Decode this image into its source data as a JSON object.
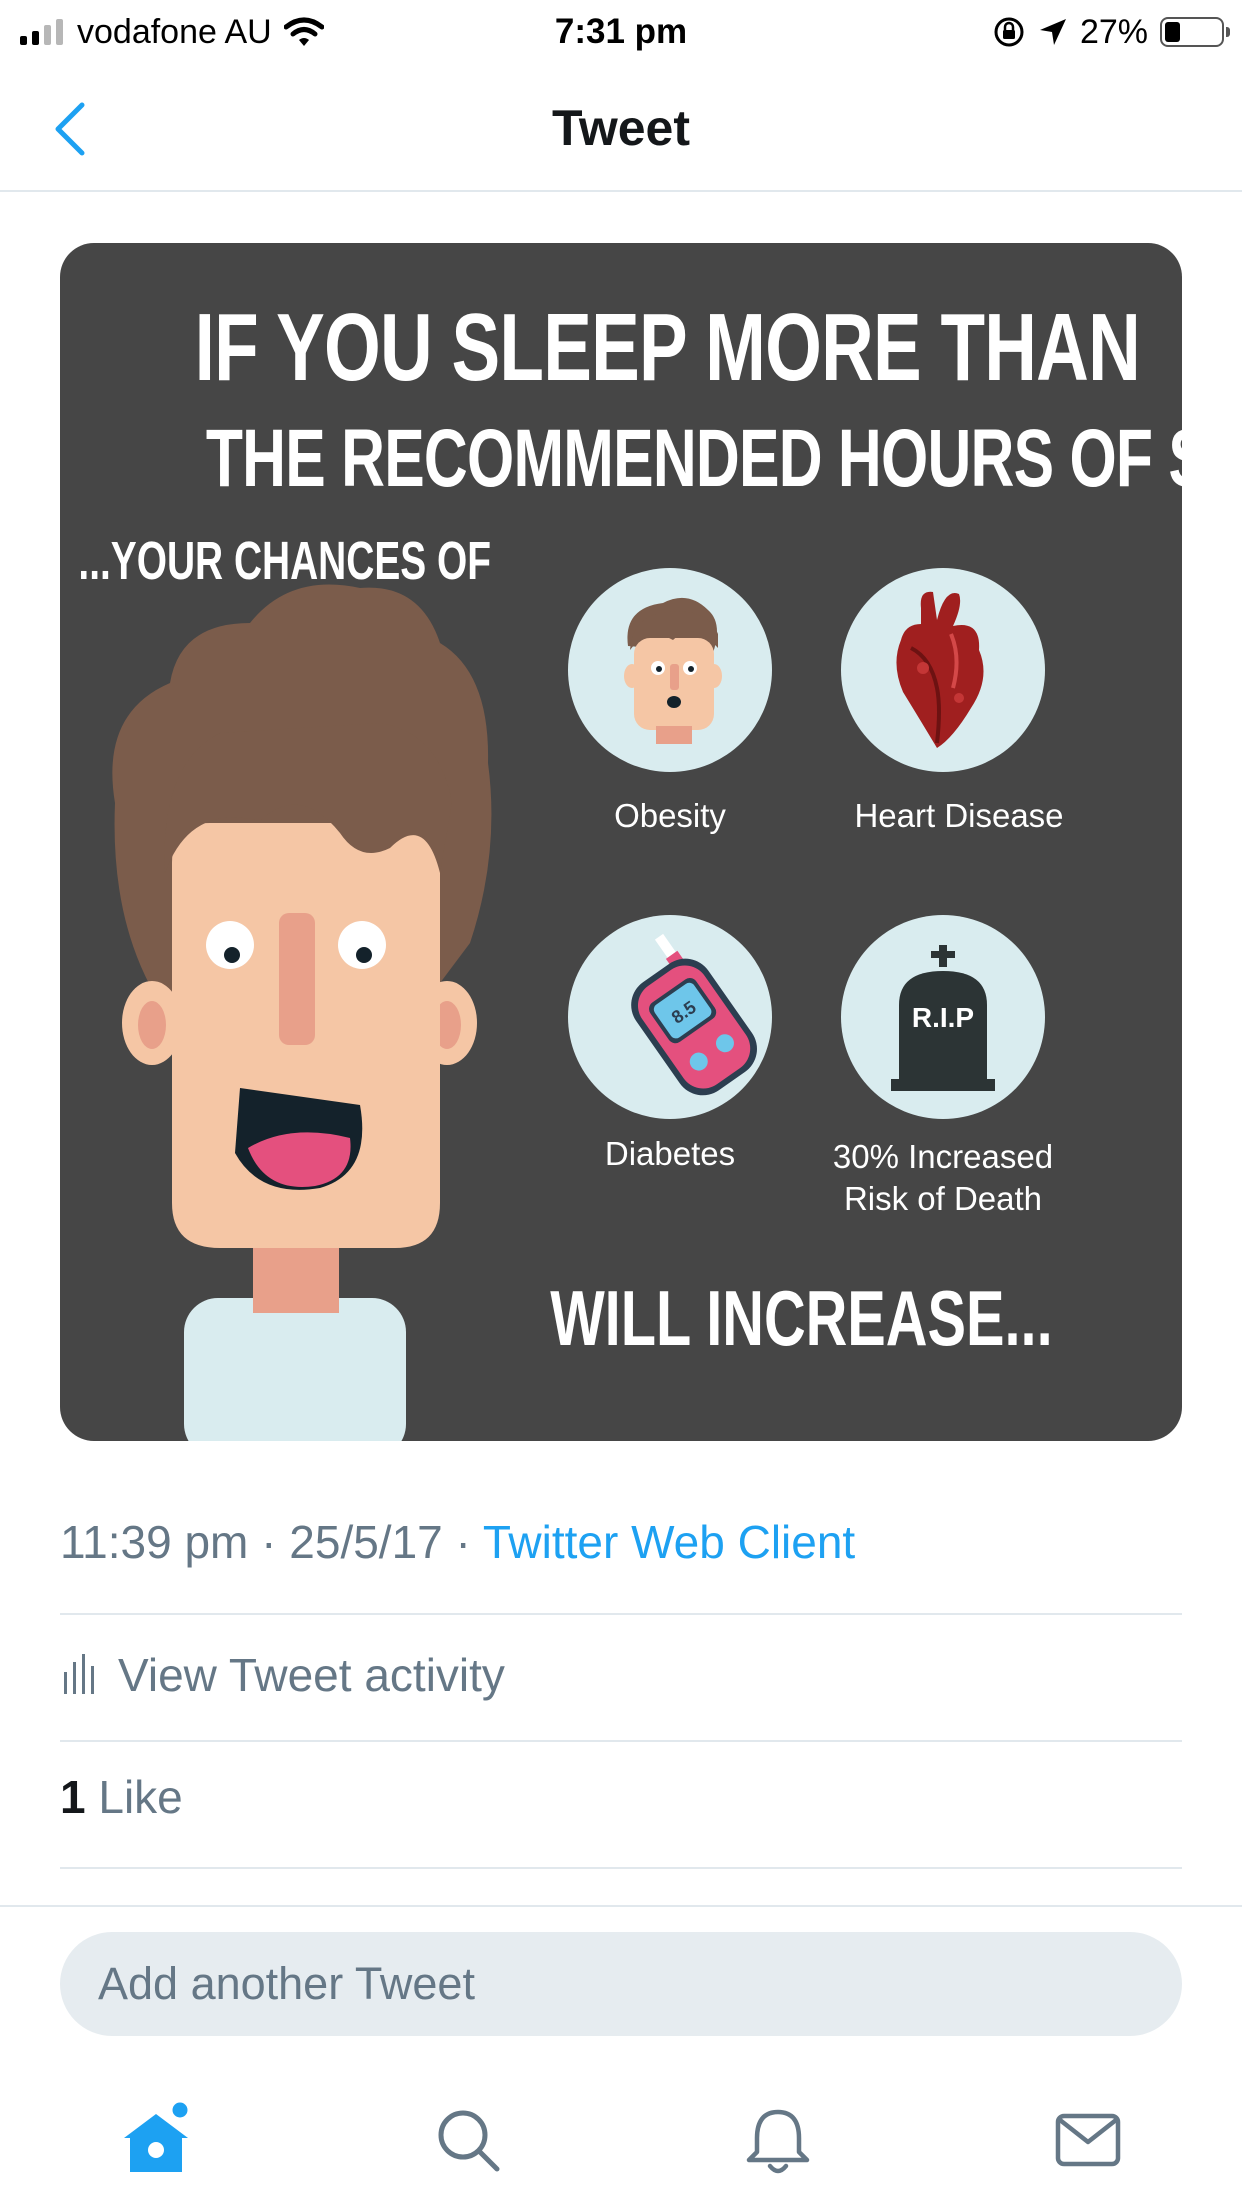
{
  "status_bar": {
    "carrier": "vodafone AU",
    "time": "7:31 pm",
    "battery": "27%",
    "battery_level": 0.27
  },
  "nav": {
    "title": "Tweet",
    "back_icon": "chevron-left-icon"
  },
  "tweet_image": {
    "headline_line1": "IF YOU SLEEP MORE THAN",
    "headline_line2": "THE RECOMMENDED HOURS OF SLEEP",
    "subline": "...YOUR CHANCES OF",
    "risks": [
      {
        "label": "Obesity",
        "icon": "obese-face-icon"
      },
      {
        "label": "Heart Disease",
        "icon": "heart-icon"
      },
      {
        "label": "Diabetes",
        "icon": "glucose-meter-icon"
      },
      {
        "label_line1": "30% Increased",
        "label_line2": "Risk of Death",
        "icon": "tombstone-icon",
        "tombstone_text": "R.I.P"
      }
    ],
    "glucose_reading": "8.5",
    "footer": "WILL INCREASE..."
  },
  "tweet_meta": {
    "time": "11:39 pm",
    "date": "25/5/17",
    "source": "Twitter Web Client",
    "separator": "·"
  },
  "activity": {
    "label": "View Tweet activity",
    "icon": "bar-chart-icon"
  },
  "likes": {
    "count": "1",
    "label": "Like"
  },
  "reply": {
    "placeholder": "Add another Tweet"
  },
  "tabbar": {
    "items": [
      {
        "name": "home",
        "icon": "home-icon"
      },
      {
        "name": "search",
        "icon": "search-icon"
      },
      {
        "name": "notifications",
        "icon": "bell-icon"
      },
      {
        "name": "messages",
        "icon": "mail-icon"
      }
    ]
  },
  "colors": {
    "accent": "#1da1f2",
    "muted_text": "#657786",
    "image_bg": "#464646",
    "circle_bg": "#d9ecef",
    "divider": "#e1e8ed"
  }
}
